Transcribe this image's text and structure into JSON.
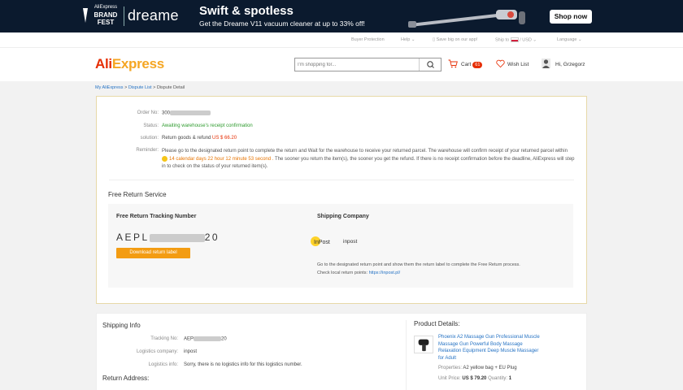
{
  "banner": {
    "fest_top": "AliExpress",
    "fest_line1": "BRAND",
    "fest_line2": "FEST",
    "brand": "dreame",
    "headline": "Swift & spotless",
    "sub": "Get the Dreame V11 vacuum cleaner at up to 33% off!",
    "cta": "Shop now"
  },
  "toplinks": {
    "buyer_protection": "Buyer Protection",
    "help": "Help",
    "save_app": "Save big on our app!",
    "ship_to": "Ship to",
    "currency": "/ USD",
    "language": "Language"
  },
  "header": {
    "logo_main": "Ali",
    "logo_accent": "Express",
    "search_placeholder": "I'm shopping for...",
    "cart_label": "Cart",
    "cart_count": "61",
    "wishlist_label": "Wish List",
    "greeting": "Hi, Grzegorz"
  },
  "breadcrumb": {
    "my": "My AliExpress",
    "list": "Dispute List",
    "current": "Dispute Detail",
    "sep": ">"
  },
  "dispute": {
    "order_label": "Order No:",
    "order_value": "300",
    "status_label": "Status:",
    "status_value": "Awaiting warehouse's receipt confirmation",
    "solution_label": "solution:",
    "solution_value": "Return goods & refund",
    "solution_amount": "US $ 66.20",
    "reminder_label": "Reminder:",
    "reminder_pre": "Please go to the designated return point to complete the return and Wait for the warehouse to receive your returned parcel. The warehouse will confirm receipt of your returned parcel within",
    "reminder_countdown": "14 calendar days 22 hour 12 minute 53 second .",
    "reminder_post": "The sooner you return the item(s), the sooner you get the refund. If there is no receipt confirmation before the deadline, AliExpress will step in to check on the status of your returned item(s)."
  },
  "free_return": {
    "title": "Free Return Service",
    "tracking_header": "Free Return Tracking Number",
    "tracking_prefix": "AEPL",
    "tracking_suffix": "20",
    "download_label": "Download return label",
    "company_header": "Shipping Company",
    "company_name": "inpost",
    "logo_text": "InPost",
    "note": "Go to the designated return point and show them the return label to complete the Free Return process.",
    "check_label": "Check local return points:",
    "check_link": "https://inpost.pl/"
  },
  "shipping": {
    "title": "Shipping Info",
    "tracking_label": "Tracking No:",
    "tracking_value": "AEP",
    "tracking_suffix": "20",
    "company_label": "Logistics company:",
    "company_value": "inpost",
    "info_label": "Logistics info:",
    "info_value": "Sorry, there is no logistics info for this logistics number.",
    "return_title": "Return Address:"
  },
  "product": {
    "title": "Product Details:",
    "name": "Phoenix A2 Massage Gun Professional Muscle Massage Gun Powerful Body Massage Relaxation Equipment Deep Muscle Massager for Adult",
    "properties_label": "Properties:",
    "properties_value": "A2 yellow bag + EU Plug",
    "unit_price_label": "Unit Price:",
    "unit_price_value": "US $ 79.20",
    "quantity_label": "Quantity:",
    "quantity_value": "1"
  },
  "colors": {
    "brand_red": "#e62e04",
    "link_blue": "#2673c4",
    "status_green": "#2f9b2f",
    "button_orange": "#f39c12",
    "banner_bg": "#0b1a2e"
  }
}
